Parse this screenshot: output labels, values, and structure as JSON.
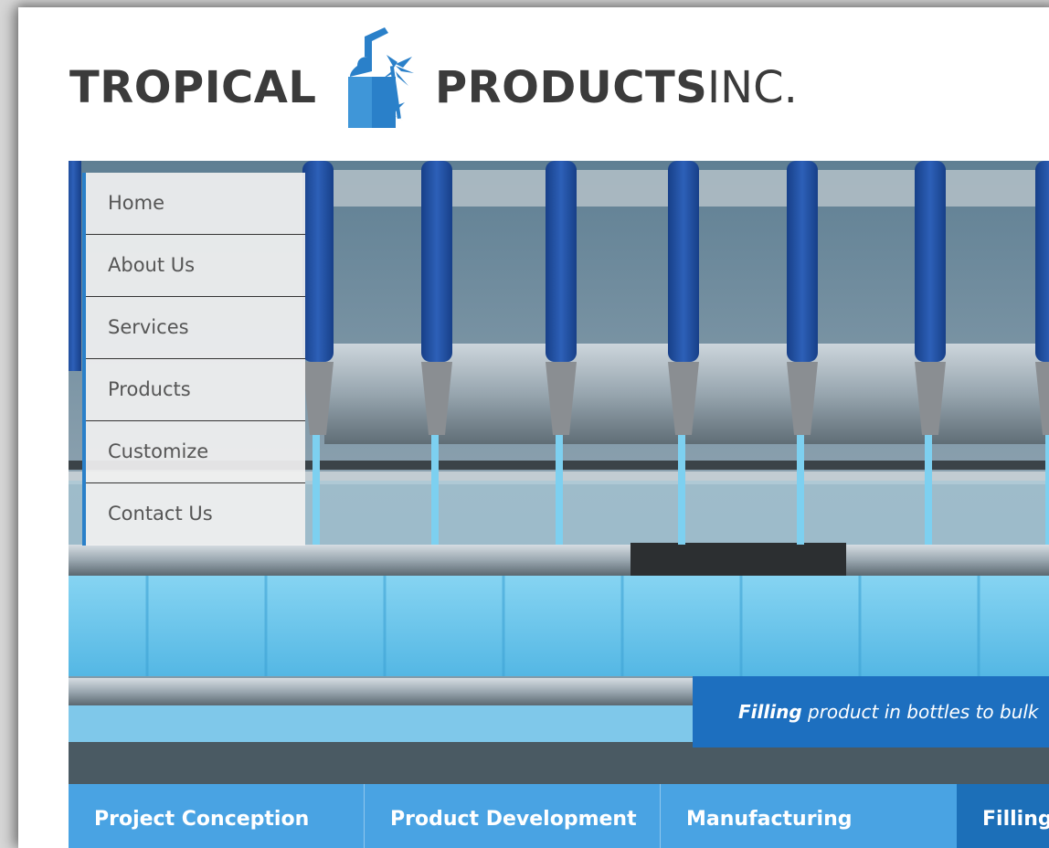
{
  "brand": {
    "word1": "TROPICAL",
    "word2": "PRODUCTS",
    "suffix": "INC.",
    "logo_icon": "bottle-palm-logo-icon",
    "brand_color": "#2a80c9",
    "text_color": "#3b3b3b"
  },
  "nav": {
    "items": [
      {
        "label": "Home"
      },
      {
        "label": "About Us"
      },
      {
        "label": "Services"
      },
      {
        "label": "Products"
      },
      {
        "label": "Customize"
      },
      {
        "label": "Contact Us"
      }
    ]
  },
  "hero": {
    "caption_bold": "Filling",
    "caption_rest": " product in bottles to bulk",
    "caption_color": "#1d6fbf"
  },
  "tabs": {
    "items": [
      {
        "label": "Project Conception"
      },
      {
        "label": "Product Development"
      },
      {
        "label": "Manufacturing"
      },
      {
        "label": "Filling"
      }
    ],
    "bar_color": "#49a3e3",
    "active_color": "#1c6fb8"
  }
}
